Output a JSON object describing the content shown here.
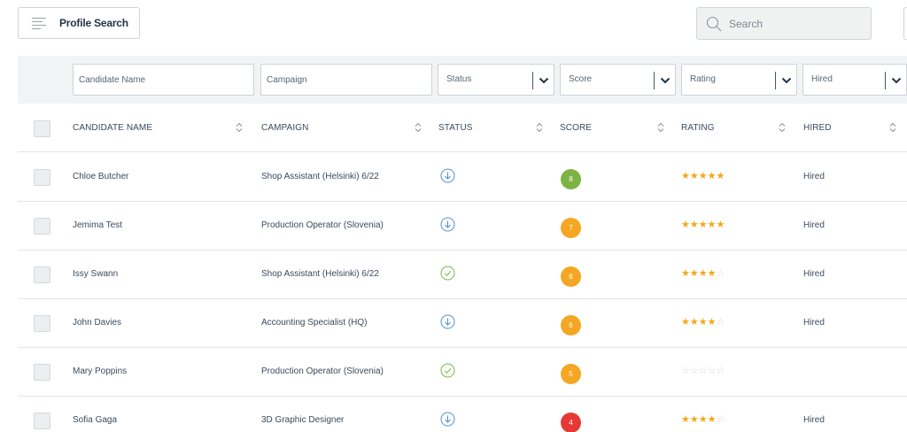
{
  "toolbar": {
    "profile_search_label": "Profile Search",
    "search_placeholder": "Search"
  },
  "filters": {
    "candidate_name_placeholder": "Candidate Name",
    "campaign_placeholder": "Campaign",
    "status_label": "Status",
    "score_label": "Score",
    "rating_label": "Rating",
    "hired_label": "Hired"
  },
  "columns": {
    "candidate_name": "CANDIDATE NAME",
    "campaign": "CAMPAIGN",
    "status": "STATUS",
    "score": "SCORE",
    "rating": "RATING",
    "hired": "HIRED"
  },
  "colors": {
    "score_green": "#7cb342",
    "score_orange": "#f5a623",
    "score_red": "#e53935",
    "status_download": "#4a90d9",
    "status_check": "#7cb342",
    "star": "#f2a816"
  },
  "rows": [
    {
      "name": "Chloe Butcher",
      "campaign": "Shop Assistant (Helsinki) 6/22",
      "status_icon": "download-circle-icon",
      "score": "8",
      "score_color": "#7cb342",
      "rating": 5,
      "hired": "Hired"
    },
    {
      "name": "Jemima Test",
      "campaign": "Production Operator (Slovenia)",
      "status_icon": "download-circle-icon",
      "score": "7",
      "score_color": "#f5a623",
      "rating": 5,
      "hired": "Hired"
    },
    {
      "name": "Issy Swann",
      "campaign": "Shop Assistant (Helsinki) 6/22",
      "status_icon": "check-circle-icon",
      "score": "6",
      "score_color": "#f5a623",
      "rating": 4,
      "hired": "Hired"
    },
    {
      "name": "John Davies",
      "campaign": "Accounting Specialist (HQ)",
      "status_icon": "download-circle-icon",
      "score": "6",
      "score_color": "#f5a623",
      "rating": 4,
      "hired": "Hired"
    },
    {
      "name": "Mary Poppins",
      "campaign": "Production Operator (Slovenia)",
      "status_icon": "check-circle-icon",
      "score": "5",
      "score_color": "#f5a623",
      "rating": 0,
      "hired": ""
    },
    {
      "name": "Sofia Gaga",
      "campaign": "3D Graphic Designer",
      "status_icon": "download-circle-icon",
      "score": "4",
      "score_color": "#e53935",
      "rating": 4,
      "hired": "Hired"
    }
  ]
}
